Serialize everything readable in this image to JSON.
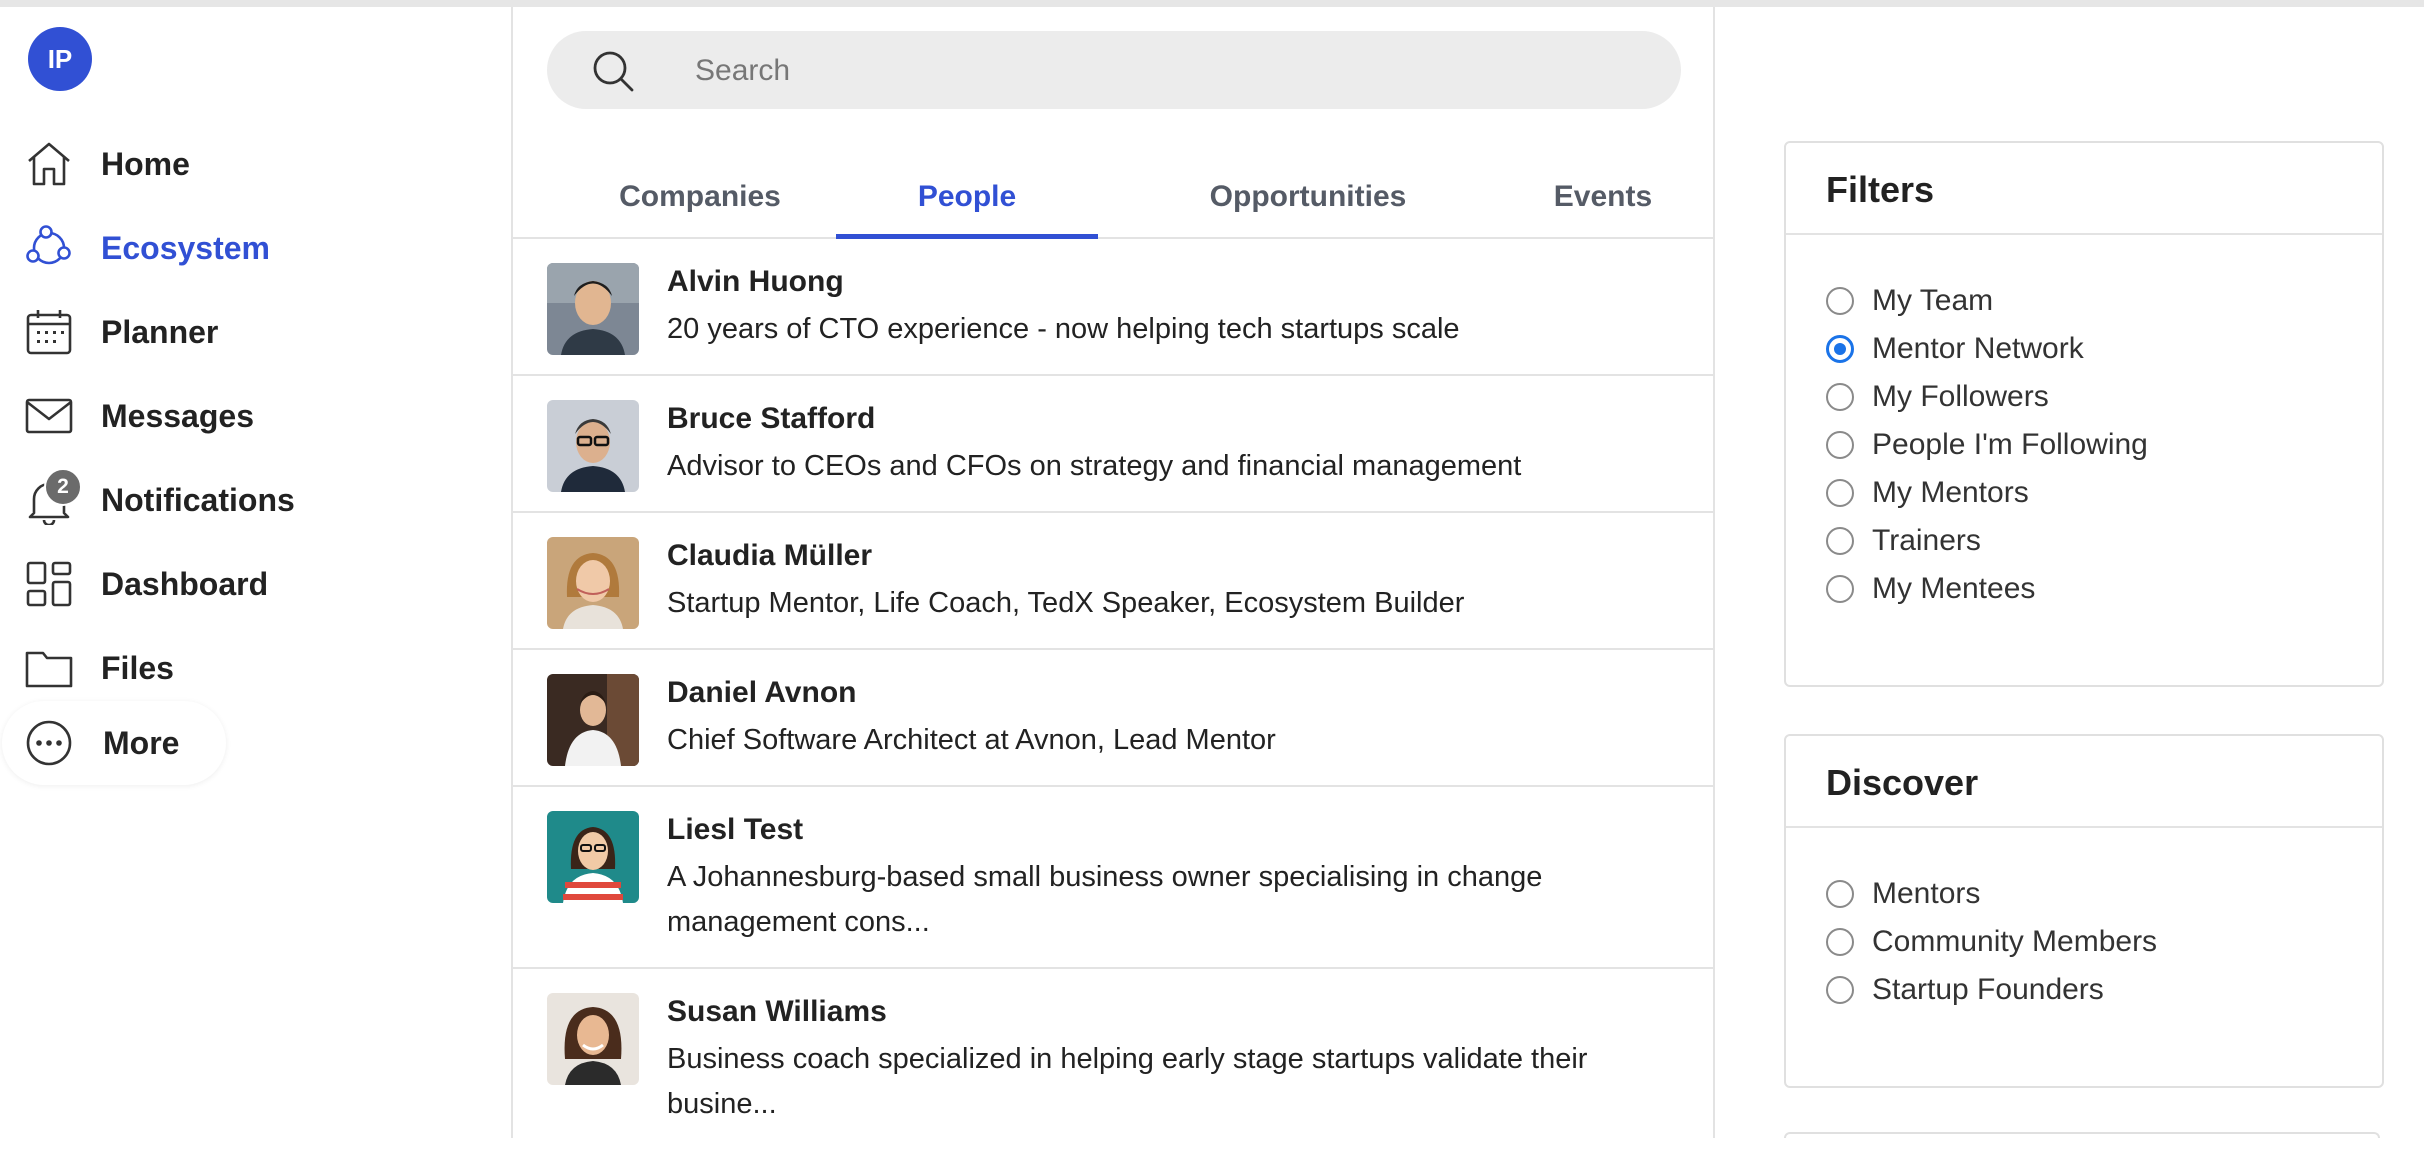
{
  "user": {
    "initials": "IP"
  },
  "nav": {
    "items": [
      {
        "label": "Home",
        "icon": "home-icon"
      },
      {
        "label": "Ecosystem",
        "icon": "ecosystem-icon",
        "active": true
      },
      {
        "label": "Planner",
        "icon": "calendar-icon"
      },
      {
        "label": "Messages",
        "icon": "mail-icon"
      },
      {
        "label": "Notifications",
        "icon": "bell-icon",
        "badge": "2"
      },
      {
        "label": "Dashboard",
        "icon": "dashboard-icon"
      },
      {
        "label": "Files",
        "icon": "folder-icon"
      },
      {
        "label": "More",
        "icon": "more-icon"
      }
    ]
  },
  "search": {
    "placeholder": "Search",
    "value": ""
  },
  "tabs": [
    {
      "label": "Companies"
    },
    {
      "label": "People",
      "active": true
    },
    {
      "label": "Opportunities"
    },
    {
      "label": "Events"
    }
  ],
  "people": [
    {
      "name": "Alvin Huong",
      "desc": "20 years of CTO experience - now helping tech startups scale"
    },
    {
      "name": "Bruce Stafford",
      "desc": "Advisor to CEOs and CFOs on strategy and financial management"
    },
    {
      "name": "Claudia Müller",
      "desc": "Startup Mentor, Life Coach, TedX Speaker, Ecosystem Builder"
    },
    {
      "name": "Daniel Avnon",
      "desc": "Chief Software Architect at Avnon, Lead Mentor"
    },
    {
      "name": "Liesl Test",
      "desc": "A Johannesburg-based small business owner specialising in change management cons..."
    },
    {
      "name": "Susan Williams",
      "desc": "Business coach specialized in helping early stage startups validate their busine..."
    }
  ],
  "filters": {
    "title": "Filters",
    "options": [
      "My Team",
      "Mentor Network",
      "My Followers",
      "People I'm Following",
      "My Mentors",
      "Trainers",
      "My Mentees"
    ],
    "selected": "Mentor Network"
  },
  "discover": {
    "title": "Discover",
    "options": [
      "Mentors",
      "Community Members",
      "Startup Founders"
    ]
  },
  "colors": {
    "accent": "#3150d4",
    "radio": "#1a73e8",
    "border": "#e3e3e3",
    "search_bg": "#ececec"
  }
}
